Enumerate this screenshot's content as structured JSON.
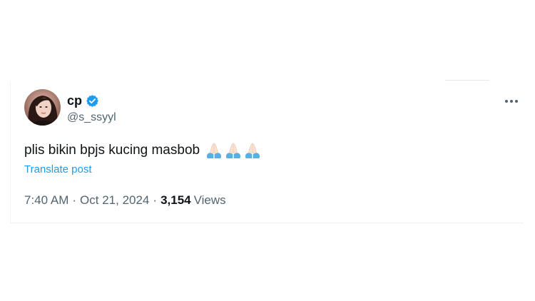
{
  "tweet": {
    "author": {
      "display_name": "cp",
      "handle": "@s_ssyyl",
      "verified": true,
      "verified_color": "#1d9bf0"
    },
    "text": "plis bikin bpjs kucing masbob",
    "emojis": [
      "pray-icon",
      "pray-icon",
      "pray-icon"
    ],
    "translate_label": "Translate post",
    "link_color": "#1d9bf0",
    "time": "7:40 AM",
    "separator": "·",
    "date": "Oct 21, 2024",
    "views_count": "3,154",
    "views_label": "Views",
    "more_icon": "more-horizontal-icon"
  }
}
